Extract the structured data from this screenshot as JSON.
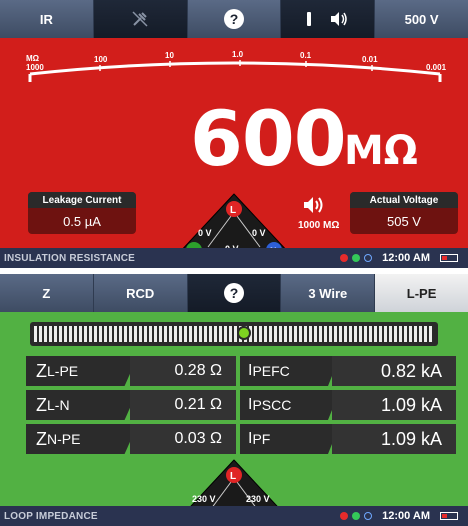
{
  "screen1": {
    "tabs": [
      {
        "label": "IR",
        "icon": null
      },
      {
        "label": "",
        "icon": "probe-off-icon"
      },
      {
        "label": "",
        "icon": "help-icon",
        "glyph": "?"
      },
      {
        "label": "",
        "icon": "speaker-icon",
        "glyph": "🔈"
      },
      {
        "label": "500 V",
        "icon": null
      }
    ],
    "scale": {
      "unit": "MΩ",
      "labels": [
        "1000",
        "100",
        "10",
        "1.0",
        "0.1",
        "0.01",
        "0.001"
      ]
    },
    "reading": {
      "value": "600",
      "unit": "MΩ"
    },
    "leakage": {
      "label": "Leakage Current",
      "value": "0.5 µA"
    },
    "actual_voltage": {
      "label": "Actual Voltage",
      "value": "505 V"
    },
    "threshold": "1000 MΩ",
    "probe": {
      "L": "L",
      "PE": "PE",
      "N": "N",
      "v_left": "0 V",
      "v_right": "0 V",
      "v_bottom": "0 V"
    },
    "status": {
      "mode": "INSULATION RESISTANCE",
      "time": "12:00 AM"
    }
  },
  "screen2": {
    "tabs": [
      {
        "label": "Z"
      },
      {
        "label": "RCD"
      },
      {
        "label": "",
        "icon": "help-icon",
        "glyph": "?"
      },
      {
        "label": "3 Wire"
      },
      {
        "label": "L-PE"
      }
    ],
    "rows": [
      {
        "name_main": "Z",
        "name_sub": "L-PE",
        "value": "0.28 Ω",
        "name2_main": "I",
        "name2_sub": "PEFC",
        "value2": "0.82 kA"
      },
      {
        "name_main": "Z",
        "name_sub": "L-N",
        "value": "0.21 Ω",
        "name2_main": "I",
        "name2_sub": "PSCC",
        "value2": "1.09 kA"
      },
      {
        "name_main": "Z",
        "name_sub": "N-PE",
        "value": "0.03 Ω",
        "name2_main": "I",
        "name2_sub": "PF",
        "value2": "1.09 kA"
      }
    ],
    "probe": {
      "L": "L",
      "PE": "PE",
      "N": "N",
      "v_left": "230 V",
      "v_right": "230 V",
      "v_bottom": "0 V"
    },
    "status": {
      "mode": "LOOP IMPEDANCE",
      "time": "12:00 AM"
    }
  },
  "colors": {
    "screen1_bg": "#d21e1b",
    "screen2_bg": "#52b143",
    "tab_bg": "#4a5a74",
    "status_bg": "#2a3350"
  }
}
